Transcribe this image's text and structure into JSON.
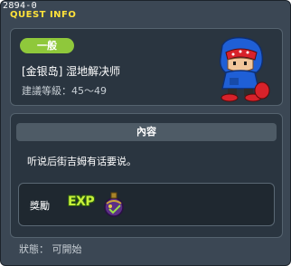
{
  "window": {
    "id": "2894-0",
    "title": "QUEST INFO"
  },
  "quest": {
    "category_badge": "一般",
    "name": "[金银岛] 湿地解决师",
    "level_requirement": "建議等級：45～49"
  },
  "content": {
    "header": "內容",
    "description": "听说后街吉姆有话要说。"
  },
  "rewards": {
    "label": "獎勵",
    "items": [
      {
        "name": "EXP",
        "icon": "exp-icon"
      },
      {
        "name": "",
        "icon": "potion-item-icon"
      }
    ]
  },
  "status": {
    "text": "狀態： 可開始"
  },
  "colors": {
    "badge_bg": "#8fc83b",
    "title_color": "#ffe23a",
    "window_bg": "#3b4754"
  }
}
